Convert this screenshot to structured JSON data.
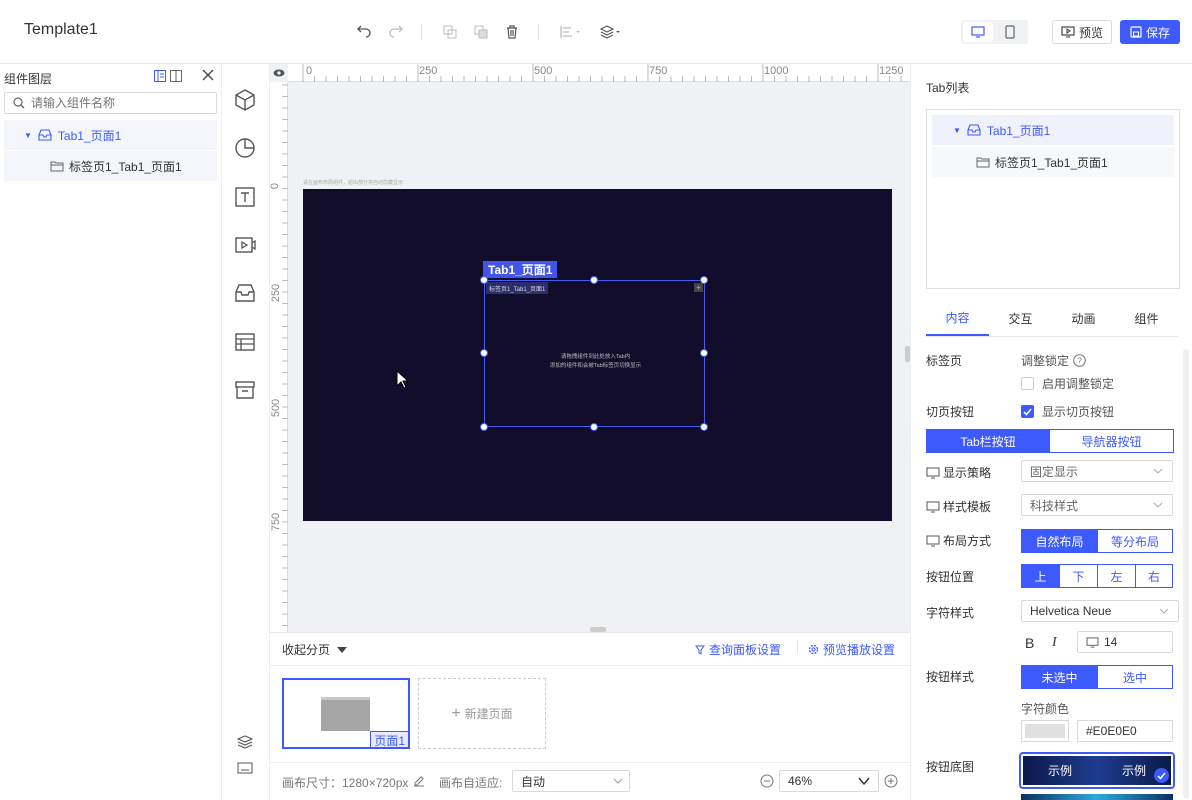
{
  "app": {
    "title": "Template1"
  },
  "toolbar": {
    "preview_label": "预览",
    "save_label": "保存"
  },
  "layers": {
    "title": "组件图层",
    "search_placeholder": "请输入组件名称",
    "items": [
      {
        "label": "Tab1_页面1"
      },
      {
        "label": "标签页1_Tab1_页面1"
      }
    ]
  },
  "ruler": {
    "top_labels": [
      "0",
      "250",
      "500",
      "750",
      "1000",
      "1250"
    ],
    "left_labels": [
      "0",
      "250",
      "500",
      "750"
    ]
  },
  "canvas": {
    "hint": "请在画布布局组件，超出部分将自动隐藏显示",
    "tab_widget": {
      "title_tag": "Tab1_页面1",
      "inner_tab": "标签页1_Tab1_页面1",
      "placeholder_line1": "请拖拽组件到此处放入Tab内",
      "placeholder_line2": "添加的组件和会被Tab标签页切换显示"
    }
  },
  "pages": {
    "collapse_label": "收起分页",
    "query_panel_label": "查询面板设置",
    "playback_label": "预览播放设置",
    "page_label": "页面1",
    "new_page_label": "新建页面"
  },
  "status": {
    "canvas_size_label": "画布尺寸：1280×720px",
    "adapt_label": "画布自适应:",
    "adapt_value": "自动",
    "zoom": "46%"
  },
  "right": {
    "tab_list_title": "Tab列表",
    "tree": [
      {
        "label": "Tab1_页面1"
      },
      {
        "label": "标签页1_Tab1_页面1"
      }
    ],
    "tabs": [
      "内容",
      "交互",
      "动画",
      "组件"
    ],
    "tab_page_label": "标签页",
    "adjust_lock_label": "调整锁定",
    "enable_lock_label": "启用调整锁定",
    "switch_btn_label": "切页按钮",
    "show_switch_label": "显示切页按钮",
    "btn_type": [
      "Tab栏按钮",
      "导航器按钮"
    ],
    "display_strategy_label": "显示策略",
    "display_strategy_value": "固定显示",
    "style_template_label": "样式模板",
    "style_template_value": "科技样式",
    "layout_label": "布局方式",
    "layout_options": [
      "自然布局",
      "等分布局"
    ],
    "btn_position_label": "按钮位置",
    "btn_position_options": [
      "上",
      "下",
      "左",
      "右"
    ],
    "font_style_label": "字符样式",
    "font_value": "Helvetica Neue",
    "bold_label": "B",
    "italic_label": "I",
    "font_size": "14",
    "btn_style_label": "按钮样式",
    "btn_style_options": [
      "未选中",
      "选中"
    ],
    "font_color_label": "字符颜色",
    "font_color_value": "#E0E0E0",
    "btn_bg_label": "按钮底图",
    "bg_sample_1": "示例",
    "bg_sample_2": "示例"
  },
  "colors": {
    "accent": "#3d5afe",
    "stage_bg": "#130d2c"
  }
}
